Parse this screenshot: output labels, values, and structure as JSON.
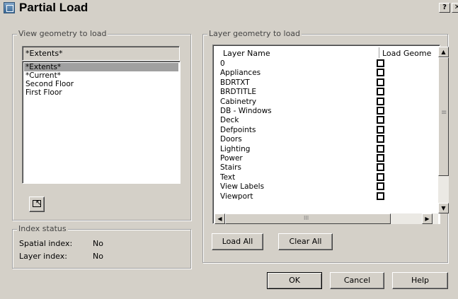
{
  "title": "Partial Load",
  "titlebar": {
    "help_glyph": "?",
    "close_glyph": "✕"
  },
  "view_group": {
    "label": "View geometry to load",
    "field_value": "*Extents*",
    "list": [
      "*Extents*",
      "*Current*",
      "Second Floor",
      "First Floor"
    ],
    "selected_index": 0
  },
  "index_group": {
    "label": "Index status",
    "spatial_label": "Spatial index:",
    "spatial_value": "No",
    "layer_label": "Layer index:",
    "layer_value": "No"
  },
  "layer_group": {
    "label": "Layer geometry to load",
    "col_name": "Layer Name",
    "col_load": "Load Geometry",
    "layers": [
      "0",
      "Appliances",
      "BDRTXT",
      "BRDTITLE",
      "Cabinetry",
      "DB - Windows",
      "Deck",
      "Defpoints",
      "Doors",
      "Lighting",
      "Power",
      "Stairs",
      "Text",
      "View Labels",
      "Viewport"
    ]
  },
  "buttons": {
    "load_all": "Load All",
    "clear_all": "Clear All",
    "ok": "OK",
    "cancel": "Cancel",
    "help": "Help"
  },
  "scroll_glyphs": {
    "up": "▲",
    "down": "▼",
    "left": "◀",
    "right": "▶"
  }
}
